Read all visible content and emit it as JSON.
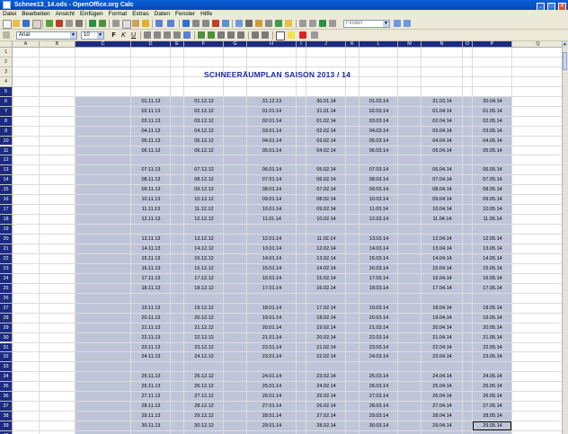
{
  "window": {
    "title": "Schnee13_14.ods - OpenOffice.org Calc"
  },
  "menu": [
    "Datei",
    "Bearbeiten",
    "Ansicht",
    "Einfügen",
    "Format",
    "Extras",
    "Daten",
    "Fenster",
    "Hilfe"
  ],
  "toolbar": {
    "find_placeholder": "Finden"
  },
  "format": {
    "font_name": "Arial",
    "font_size": "10",
    "bold": "F",
    "italic": "K",
    "underline": "U"
  },
  "columns": [
    "A",
    "B",
    "C",
    "D",
    "E",
    "F",
    "G",
    "H",
    "I",
    "J",
    "K",
    "L",
    "M",
    "N",
    "O",
    "P",
    "Q"
  ],
  "rows": [
    "1",
    "2",
    "3",
    "4",
    "5",
    "6",
    "7",
    "8",
    "9",
    "10",
    "11",
    "12",
    "13",
    "14",
    "15",
    "16",
    "17",
    "18",
    "19",
    "20",
    "21",
    "22",
    "23",
    "24",
    "25",
    "26",
    "27",
    "28",
    "29",
    "30",
    "31",
    "32",
    "33",
    "34",
    "35",
    "36",
    "37",
    "38",
    "39",
    "40"
  ],
  "sheet_title": "SCHNEERÄUMPLAN  SAISON  2013 / 14",
  "date_blocks": [
    [
      [
        "01.11.13",
        "01.12.12",
        "31.12.13",
        "30.01.14",
        "01.03.14",
        "31.03.14",
        "30.04.14"
      ],
      [
        "02.11.13",
        "02.12.12",
        "01.01.14",
        "31.01.14",
        "02.03.14",
        "01.04.14",
        "01.05.14"
      ],
      [
        "03.11.13",
        "03.12.12",
        "02.01.14",
        "01.02.14",
        "03.03.14",
        "02.04.14",
        "02.05.14"
      ],
      [
        "04.11.13",
        "04.12.12",
        "03.01.14",
        "02.02.14",
        "04.03.14",
        "03.04.14",
        "03.05.14"
      ],
      [
        "05.11.13",
        "05.12.12",
        "04.01.14",
        "03.02.14",
        "05.03.14",
        "04.04.14",
        "04.05.14"
      ],
      [
        "06.11.13",
        "06.12.12",
        "05.01.14",
        "04.02.14",
        "06.03.14",
        "05.04.14",
        "05.05.14"
      ]
    ],
    [
      [
        "07.11.13",
        "07.12.12",
        "06.01.14",
        "05.02.14",
        "07.03.14",
        "06.04.14",
        "06.05.14"
      ],
      [
        "08.11.13",
        "08.12.12",
        "07.01.14",
        "06.02.14",
        "08.03.14",
        "07.04.14",
        "07.05.14"
      ],
      [
        "09.11.13",
        "09.12.12",
        "08.01.14",
        "07.02.14",
        "09.03.14",
        "08.04.14",
        "08.05.14"
      ],
      [
        "10.11.13",
        "10.12.12",
        "09.01.14",
        "08.02.14",
        "10.03.14",
        "09.04.14",
        "09.05.14"
      ],
      [
        "11.11.13",
        "11.12.12",
        "10.01.14",
        "09.02.14",
        "11.03.14",
        "10.04.14",
        "10.05.14"
      ],
      [
        "12.11.13",
        "12.12.12",
        "11.01.14",
        "10.02.14",
        "12.03.14",
        "11.04.14",
        "11.05.14"
      ]
    ],
    [
      [
        "13.11.13",
        "13.12.12",
        "12.01.14",
        "11.02.14",
        "13.03.14",
        "12.04.14",
        "12.05.14"
      ],
      [
        "14.11.13",
        "14.12.12",
        "13.01.14",
        "12.02.14",
        "14.03.14",
        "13.04.14",
        "13.05.14"
      ],
      [
        "15.11.13",
        "15.12.12",
        "14.01.14",
        "13.02.14",
        "15.03.14",
        "14.04.14",
        "14.05.14"
      ],
      [
        "16.11.13",
        "16.12.12",
        "15.01.14",
        "14.02.14",
        "16.03.14",
        "15.04.14",
        "15.05.14"
      ],
      [
        "17.11.13",
        "17.12.12",
        "16.01.14",
        "15.02.14",
        "17.03.14",
        "16.04.14",
        "16.05.14"
      ],
      [
        "18.11.13",
        "18.12.12",
        "17.01.14",
        "16.02.14",
        "18.03.14",
        "17.04.14",
        "17.05.14"
      ]
    ],
    [
      [
        "19.11.13",
        "19.12.12",
        "18.01.14",
        "17.02.14",
        "19.03.14",
        "18.04.14",
        "18.05.14"
      ],
      [
        "20.11.13",
        "20.12.12",
        "19.01.14",
        "18.02.14",
        "20.03.14",
        "19.04.14",
        "19.05.14"
      ],
      [
        "21.11.13",
        "21.12.12",
        "20.01.14",
        "19.02.14",
        "21.03.14",
        "20.04.14",
        "20.05.14"
      ],
      [
        "22.11.13",
        "22.12.12",
        "21.01.14",
        "20.02.14",
        "22.03.14",
        "21.04.14",
        "21.05.14"
      ],
      [
        "23.11.13",
        "23.12.12",
        "22.01.14",
        "21.02.14",
        "23.03.14",
        "22.04.14",
        "22.05.14"
      ],
      [
        "24.11.13",
        "24.12.12",
        "23.01.14",
        "22.02.14",
        "24.03.14",
        "23.04.14",
        "23.05.14"
      ]
    ],
    [
      [
        "25.11.13",
        "25.12.12",
        "24.01.14",
        "23.02.14",
        "25.03.14",
        "24.04.14",
        "24.05.14"
      ],
      [
        "26.11.13",
        "26.12.12",
        "25.01.14",
        "24.02.14",
        "26.03.14",
        "25.04.14",
        "25.05.14"
      ],
      [
        "27.11.13",
        "27.12.12",
        "26.01.14",
        "25.02.14",
        "27.03.14",
        "26.04.14",
        "26.05.14"
      ],
      [
        "28.11.13",
        "28.12.12",
        "27.01.14",
        "26.02.14",
        "28.03.14",
        "27.04.14",
        "27.05.14"
      ],
      [
        "29.11.13",
        "29.12.12",
        "28.01.14",
        "27.02.14",
        "29.03.14",
        "28.04.14",
        "28.05.14"
      ],
      [
        "30.11.13",
        "30.12.12",
        "29.01.14",
        "28.02.14",
        "30.03.14",
        "29.04.14",
        "29.05.14"
      ]
    ]
  ],
  "colors": {
    "selection": "#bfc5d9",
    "title": "#1a2aa0",
    "header_selected": "#1c2b80",
    "titlebar": "#0a5fd8"
  }
}
